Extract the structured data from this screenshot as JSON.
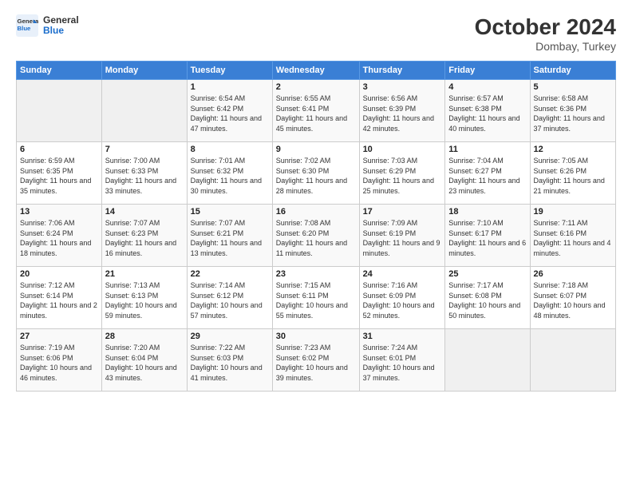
{
  "header": {
    "logo_line1": "General",
    "logo_line2": "Blue",
    "month": "October 2024",
    "location": "Dombay, Turkey"
  },
  "weekdays": [
    "Sunday",
    "Monday",
    "Tuesday",
    "Wednesday",
    "Thursday",
    "Friday",
    "Saturday"
  ],
  "weeks": [
    [
      {
        "day": "",
        "info": ""
      },
      {
        "day": "",
        "info": ""
      },
      {
        "day": "1",
        "info": "Sunrise: 6:54 AM\nSunset: 6:42 PM\nDaylight: 11 hours and 47 minutes."
      },
      {
        "day": "2",
        "info": "Sunrise: 6:55 AM\nSunset: 6:41 PM\nDaylight: 11 hours and 45 minutes."
      },
      {
        "day": "3",
        "info": "Sunrise: 6:56 AM\nSunset: 6:39 PM\nDaylight: 11 hours and 42 minutes."
      },
      {
        "day": "4",
        "info": "Sunrise: 6:57 AM\nSunset: 6:38 PM\nDaylight: 11 hours and 40 minutes."
      },
      {
        "day": "5",
        "info": "Sunrise: 6:58 AM\nSunset: 6:36 PM\nDaylight: 11 hours and 37 minutes."
      }
    ],
    [
      {
        "day": "6",
        "info": "Sunrise: 6:59 AM\nSunset: 6:35 PM\nDaylight: 11 hours and 35 minutes."
      },
      {
        "day": "7",
        "info": "Sunrise: 7:00 AM\nSunset: 6:33 PM\nDaylight: 11 hours and 33 minutes."
      },
      {
        "day": "8",
        "info": "Sunrise: 7:01 AM\nSunset: 6:32 PM\nDaylight: 11 hours and 30 minutes."
      },
      {
        "day": "9",
        "info": "Sunrise: 7:02 AM\nSunset: 6:30 PM\nDaylight: 11 hours and 28 minutes."
      },
      {
        "day": "10",
        "info": "Sunrise: 7:03 AM\nSunset: 6:29 PM\nDaylight: 11 hours and 25 minutes."
      },
      {
        "day": "11",
        "info": "Sunrise: 7:04 AM\nSunset: 6:27 PM\nDaylight: 11 hours and 23 minutes."
      },
      {
        "day": "12",
        "info": "Sunrise: 7:05 AM\nSunset: 6:26 PM\nDaylight: 11 hours and 21 minutes."
      }
    ],
    [
      {
        "day": "13",
        "info": "Sunrise: 7:06 AM\nSunset: 6:24 PM\nDaylight: 11 hours and 18 minutes."
      },
      {
        "day": "14",
        "info": "Sunrise: 7:07 AM\nSunset: 6:23 PM\nDaylight: 11 hours and 16 minutes."
      },
      {
        "day": "15",
        "info": "Sunrise: 7:07 AM\nSunset: 6:21 PM\nDaylight: 11 hours and 13 minutes."
      },
      {
        "day": "16",
        "info": "Sunrise: 7:08 AM\nSunset: 6:20 PM\nDaylight: 11 hours and 11 minutes."
      },
      {
        "day": "17",
        "info": "Sunrise: 7:09 AM\nSunset: 6:19 PM\nDaylight: 11 hours and 9 minutes."
      },
      {
        "day": "18",
        "info": "Sunrise: 7:10 AM\nSunset: 6:17 PM\nDaylight: 11 hours and 6 minutes."
      },
      {
        "day": "19",
        "info": "Sunrise: 7:11 AM\nSunset: 6:16 PM\nDaylight: 11 hours and 4 minutes."
      }
    ],
    [
      {
        "day": "20",
        "info": "Sunrise: 7:12 AM\nSunset: 6:14 PM\nDaylight: 11 hours and 2 minutes."
      },
      {
        "day": "21",
        "info": "Sunrise: 7:13 AM\nSunset: 6:13 PM\nDaylight: 10 hours and 59 minutes."
      },
      {
        "day": "22",
        "info": "Sunrise: 7:14 AM\nSunset: 6:12 PM\nDaylight: 10 hours and 57 minutes."
      },
      {
        "day": "23",
        "info": "Sunrise: 7:15 AM\nSunset: 6:11 PM\nDaylight: 10 hours and 55 minutes."
      },
      {
        "day": "24",
        "info": "Sunrise: 7:16 AM\nSunset: 6:09 PM\nDaylight: 10 hours and 52 minutes."
      },
      {
        "day": "25",
        "info": "Sunrise: 7:17 AM\nSunset: 6:08 PM\nDaylight: 10 hours and 50 minutes."
      },
      {
        "day": "26",
        "info": "Sunrise: 7:18 AM\nSunset: 6:07 PM\nDaylight: 10 hours and 48 minutes."
      }
    ],
    [
      {
        "day": "27",
        "info": "Sunrise: 7:19 AM\nSunset: 6:06 PM\nDaylight: 10 hours and 46 minutes."
      },
      {
        "day": "28",
        "info": "Sunrise: 7:20 AM\nSunset: 6:04 PM\nDaylight: 10 hours and 43 minutes."
      },
      {
        "day": "29",
        "info": "Sunrise: 7:22 AM\nSunset: 6:03 PM\nDaylight: 10 hours and 41 minutes."
      },
      {
        "day": "30",
        "info": "Sunrise: 7:23 AM\nSunset: 6:02 PM\nDaylight: 10 hours and 39 minutes."
      },
      {
        "day": "31",
        "info": "Sunrise: 7:24 AM\nSunset: 6:01 PM\nDaylight: 10 hours and 37 minutes."
      },
      {
        "day": "",
        "info": ""
      },
      {
        "day": "",
        "info": ""
      }
    ]
  ]
}
